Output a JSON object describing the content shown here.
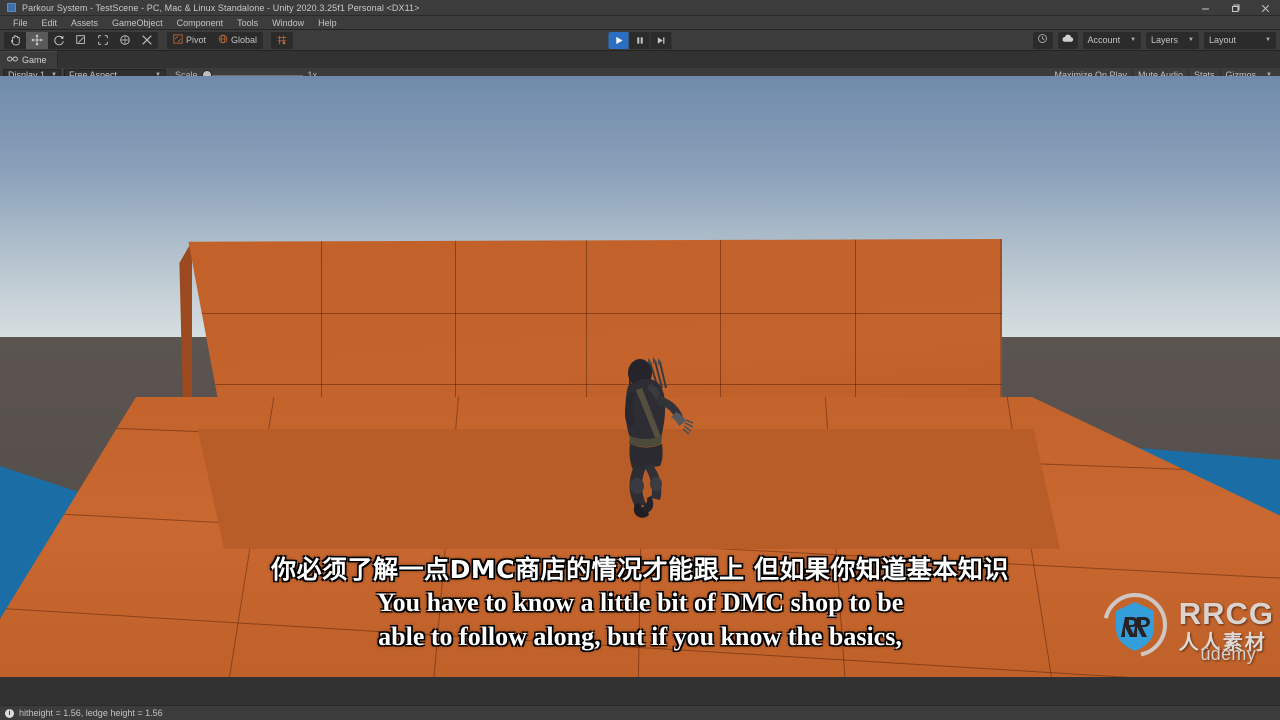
{
  "window": {
    "title": "Parkour System - TestScene - PC, Mac & Linux Standalone - Unity 2020.3.25f1 Personal <DX11>",
    "app_icon": "unity-icon",
    "minimize": "—",
    "restore": "❐",
    "close": "✕"
  },
  "menubar": {
    "items": [
      {
        "label": "File"
      },
      {
        "label": "Edit"
      },
      {
        "label": "Assets"
      },
      {
        "label": "GameObject"
      },
      {
        "label": "Component"
      },
      {
        "label": "Tools"
      },
      {
        "label": "Window"
      },
      {
        "label": "Help"
      }
    ]
  },
  "toolbar": {
    "tools": [
      {
        "name": "hand-tool",
        "icon": "hand-icon"
      },
      {
        "name": "move-tool",
        "icon": "move-icon",
        "active": true
      },
      {
        "name": "rotate-tool",
        "icon": "rotate-icon"
      },
      {
        "name": "scale-tool",
        "icon": "scale-icon"
      },
      {
        "name": "rect-tool",
        "icon": "rect-icon"
      },
      {
        "name": "transform-tool",
        "icon": "transform-icon"
      },
      {
        "name": "custom-tool",
        "icon": "wrench-icon"
      }
    ],
    "pivot_label": "Pivot",
    "pivot_icon": "pivot-icon",
    "global_label": "Global",
    "global_icon": "globe-icon",
    "snap_icon": "grid-snap-icon",
    "play_label": "▶",
    "pause_label": "❚❚",
    "step_label": "▶❘",
    "play_active": true,
    "collab_icon": "collab-icon",
    "cloud_icon": "cloud-icon",
    "account_label": "Account",
    "layers_label": "Layers",
    "layout_label": "Layout"
  },
  "gameview": {
    "tab_label": "Game",
    "tab_icon": "game-icon",
    "display_label": "Display 1",
    "aspect_label": "Free Aspect",
    "scale_label": "Scale",
    "scale_value": "1x",
    "maximize_label": "Maximize On Play",
    "mute_label": "Mute Audio",
    "stats_label": "Stats",
    "gizmos_label": "Gizmos"
  },
  "subtitles": {
    "chinese": "你必须了解一点DMC商店的情况才能跟上 但如果你知道基本知识",
    "english_line1": "You have to know a little bit of DMC shop to be",
    "english_line2": "able to follow along, but if you know the basics,"
  },
  "watermark": {
    "brand": "RRCG",
    "brand_cn": "人人素材",
    "platform": "ûdemy",
    "logo_icon": "rrcg-shield-icon"
  },
  "statusbar": {
    "icon": "info-icon",
    "message": "hitheight = 1.56, ledge height = 1.56"
  },
  "scene": {
    "colors": {
      "wall_orange": "#c3622a",
      "floor_blue": "#1a6ea5",
      "ground_gray": "#57504e",
      "sky_top": "#6f8aaa",
      "sky_horizon": "#d8dfe1"
    },
    "character_name": "ninja-archer-character"
  }
}
